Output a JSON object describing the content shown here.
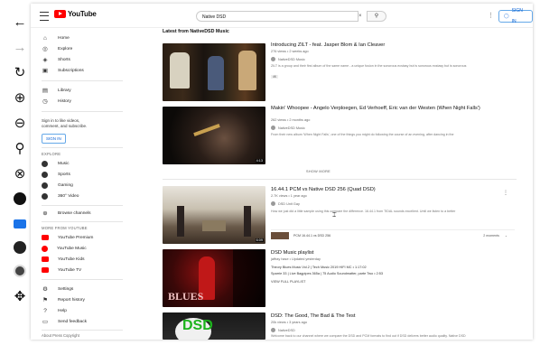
{
  "header": {
    "logo_text": "YouTube",
    "search_value": "Native DSD",
    "search_clear": "×",
    "search_icon": "search-icon",
    "signin_label": "SIGN IN"
  },
  "sidebar": {
    "main": [
      {
        "label": "Home",
        "icon": "home-icon"
      },
      {
        "label": "Explore",
        "icon": "explore-icon"
      },
      {
        "label": "Shorts",
        "icon": "shorts-icon"
      },
      {
        "label": "Subscriptions",
        "icon": "subscriptions-icon"
      }
    ],
    "library": [
      {
        "label": "Library",
        "icon": "library-icon"
      },
      {
        "label": "History",
        "icon": "history-icon"
      }
    ],
    "signin_text": "Sign in to like videos, comment, and subscribe.",
    "signin_button": "SIGN IN",
    "explore_header": "EXPLORE",
    "explore": [
      {
        "label": "Music"
      },
      {
        "label": "Sports"
      },
      {
        "label": "Gaming"
      },
      {
        "label": "360° Video"
      }
    ],
    "browse_channels": "Browse channels",
    "more_header": "MORE FROM YOUTUBE",
    "more": [
      {
        "label": "YouTube Premium"
      },
      {
        "label": "YouTube Music"
      },
      {
        "label": "YouTube Kids"
      },
      {
        "label": "YouTube TV"
      }
    ],
    "settings": [
      {
        "label": "Settings",
        "icon": "gear-icon"
      },
      {
        "label": "Report history",
        "icon": "flag-icon"
      },
      {
        "label": "Help",
        "icon": "help-icon"
      },
      {
        "label": "Send feedback",
        "icon": "feedback-icon"
      }
    ],
    "footer": "About Press Copyright"
  },
  "main": {
    "section_title": "Latest from NativeDSD Music",
    "show_more": "SHOW MORE",
    "videos": [
      {
        "title": "Introducing ZILT - feat. Jasper Blom & Ian Cleaver",
        "meta": "276 views • 2 weeks ago",
        "channel": "NativeDSD Music",
        "description": "ZILT is a group and their first album of the same name - a unique fusion in the sonorous ecstasy but is sonorous ecstasy but is sonorous",
        "badge": "4K"
      },
      {
        "title": "Makin' Whoopee - Angelo Verploegen, Ed Verhoeff, Eric van der Westen (When Night Falls')",
        "meta": "262 views • 2 months ago",
        "channel": "NativeDSD Music",
        "description": "From their new album 'When Night Falls', one of the things you might do following the course of an evening, after dancing in the",
        "duration": "4:13"
      },
      {
        "title": "16.44.1 PCM vs Native DSD 256 (Quad DSD)",
        "meta": "2.7K views • 1 year ago",
        "channel": "DSD Unit Gay",
        "description": "How we just did a little sample using this compare the difference. 16.44.1 from TIDAL sounds excellent. Until we listen to a better",
        "moment_label": "PCM 16.44.1 vs DSD 256",
        "moments_count": "2 moments",
        "duration": "6:09"
      },
      {
        "title": "DSD Music playlist",
        "meta": "jaffray hase • Updated yesterday",
        "line1": "Theory Blues Music Vol.2 | Tech Music 2019 HIFI MC • 1:17:02",
        "line2": "Sparrie 33 | Live Bagpipes 365a | 75 Audio Soundmatter, parte Two • 2:53",
        "view_full": "VIEW FULL PLAYLIST",
        "thumb_text": "BLUES"
      },
      {
        "title": "DSD: The Good, The Bad & The Test",
        "meta": "20k views • 3 years ago",
        "channel": "NativeDSD",
        "description": "Welcome back to our channel where we compare the DSD and PCM formats to find out if DSD delivers better audio quality. Native DSD",
        "thumb_text": "DSD"
      }
    ]
  },
  "colors": {
    "youtube_red": "#ff0000",
    "link_blue": "#065fd4"
  }
}
